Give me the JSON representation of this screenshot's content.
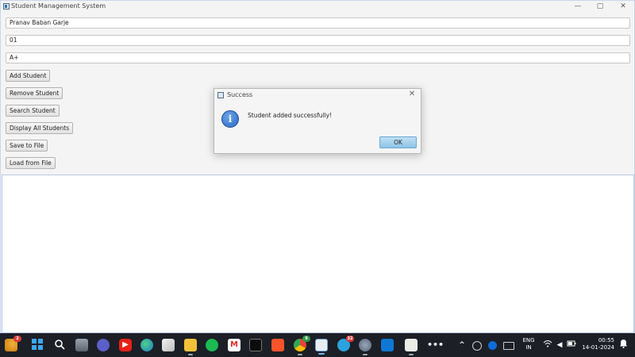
{
  "window": {
    "title": "Student Management System",
    "controls": {
      "minimize": "—",
      "maximize": "▢",
      "close": "✕"
    }
  },
  "form": {
    "name_value": "Pranav Baban Garje",
    "roll_value": "01",
    "grade_value": "A+"
  },
  "buttons": {
    "add": "Add Student",
    "remove": "Remove Student",
    "search": "Search Student",
    "display": "Display All Students",
    "save": "Save to File",
    "load": "Load from File"
  },
  "dialog": {
    "title": "Success",
    "message": "Student added successfully!",
    "ok_label": "OK",
    "info_glyph": "i",
    "close_glyph": "✕"
  },
  "taskbar": {
    "weather_badge": "2",
    "chrome_badge": "9",
    "telegram_badge": "32",
    "language_line1": "ENG",
    "language_line2": "IN",
    "time": "00:55",
    "date": "14-01-2024"
  },
  "colors": {
    "dialog_ok": "#8fc3e6",
    "info_icon": "#2b67c2",
    "taskbar": "#1c1f26",
    "output_border": "#b7c7e3"
  }
}
